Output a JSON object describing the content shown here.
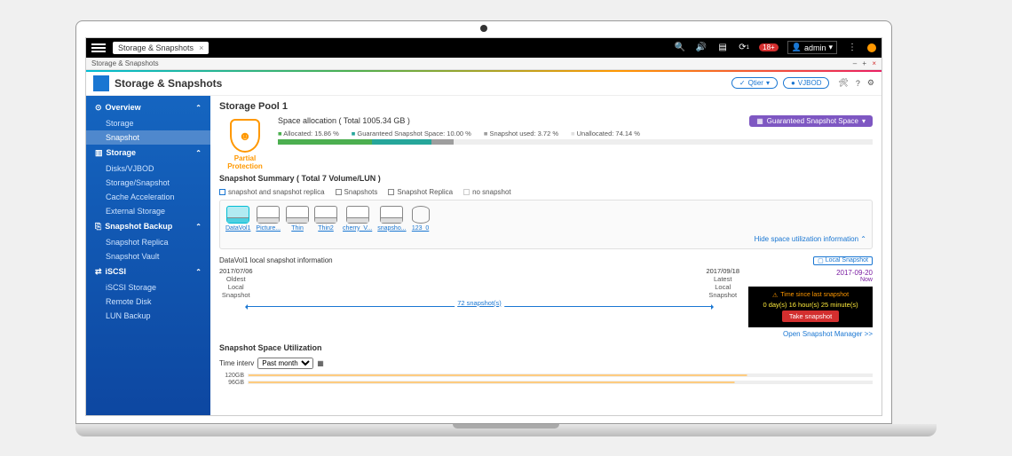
{
  "topbar": {
    "tab_title": "Storage & Snapshots",
    "search_icon": "search-icon",
    "notification_count": "18+",
    "user_label": "admin"
  },
  "crumb": {
    "text": "Storage & Snapshots",
    "min": "–",
    "max": "+",
    "close": "×"
  },
  "header": {
    "title": "Storage & Snapshots",
    "pill_qtier": "Qtier",
    "pill_vjbod": "VJBOD"
  },
  "sidebar": {
    "groups": [
      {
        "label": "Overview",
        "items": [
          "Storage",
          "Snapshot"
        ]
      },
      {
        "label": "Storage",
        "items": [
          "Disks/VJBOD",
          "Storage/Snapshot",
          "Cache Acceleration",
          "External Storage"
        ]
      },
      {
        "label": "Snapshot Backup",
        "items": [
          "Snapshot Replica",
          "Snapshot Vault"
        ]
      },
      {
        "label": "iSCSI",
        "items": [
          "iSCSI Storage",
          "Remote Disk",
          "LUN Backup"
        ]
      }
    ],
    "active": "Snapshot"
  },
  "pool": {
    "title": "Storage Pool 1"
  },
  "protection": {
    "label": "Partial Protection"
  },
  "allocation": {
    "title": "Space allocation ( Total 1005.34 GB )",
    "btn": "Guaranteed Snapshot Space",
    "legend": {
      "allocated": "Allocated: 15.86 %",
      "guaranteed": "Guaranteed Snapshot Space: 10.00 %",
      "used": "Snapshot used: 3.72 %",
      "unalloc": "Unallocated: 74.14 %"
    }
  },
  "summary": {
    "title": "Snapshot Summary ( Total 7 Volume/LUN )"
  },
  "filters": {
    "f1": "snapshot and snapshot replica",
    "f2": "Snapshots",
    "f3": "Snapshot Replica",
    "f4": "no snapshot"
  },
  "volumes": [
    "DataVol1",
    "Picture...",
    "Thin",
    "Thin2",
    "cherry_V...",
    "snapsho...",
    "123_0"
  ],
  "hide_link": "Hide space utilization information",
  "info": {
    "title": "DataVol1 local snapshot information",
    "local_badge": "Local Snapshot",
    "oldest": {
      "date": "2017/07/06",
      "l1": "Oldest",
      "l2": "Local",
      "l3": "Snapshot"
    },
    "latest": {
      "date": "2017/09/18",
      "l1": "Latest",
      "l2": "Local",
      "l3": "Snapshot"
    },
    "count": "72 snapshot(s)",
    "now_date": "2017-09-20",
    "now": "Now",
    "warn_title": "Time since last snapshot",
    "warn_time": "0 day(s) 16 hour(s) 25 minute(s)",
    "take_btn": "Take snapshot",
    "manager_link": "Open Snapshot Manager >>"
  },
  "util": {
    "title": "Snapshot Space Utilization",
    "interval_label": "Time interv",
    "interval_value": "Past month"
  },
  "chart_data": {
    "type": "bar",
    "categories": [
      "120GB",
      "96GB"
    ],
    "values": [
      80,
      78
    ],
    "title": "Snapshot Space Utilization",
    "xlabel": "",
    "ylabel": "",
    "ylim": [
      0,
      100
    ]
  }
}
